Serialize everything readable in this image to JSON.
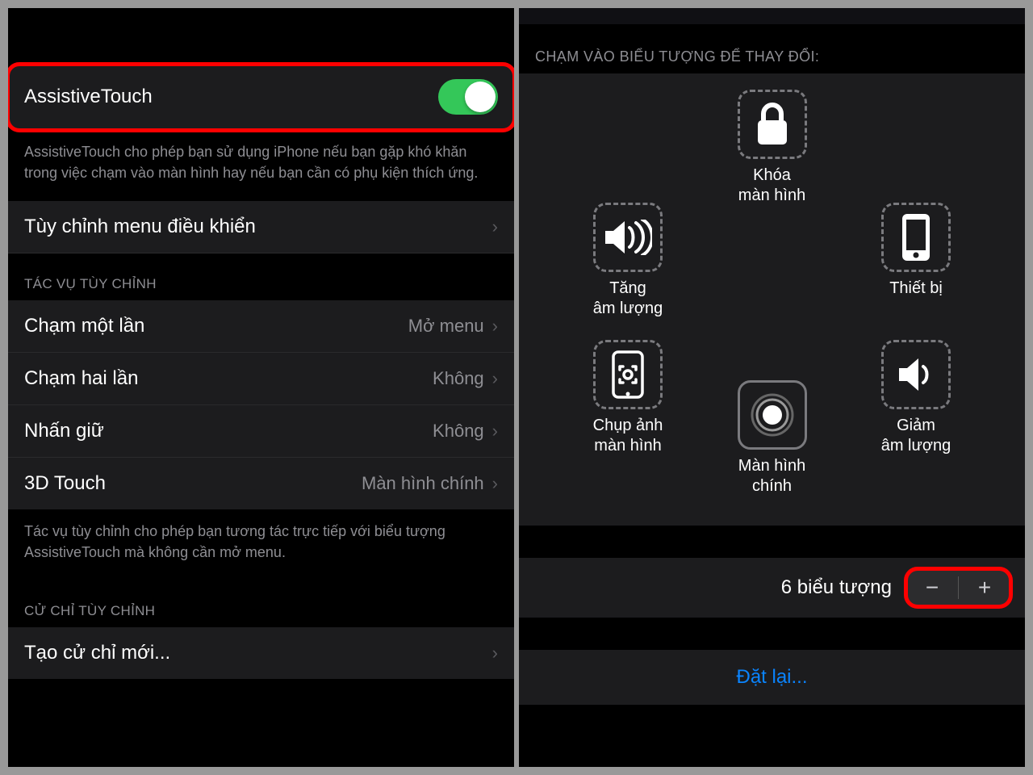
{
  "left": {
    "toggle_row": {
      "label": "AssistiveTouch"
    },
    "toggle_desc": "AssistiveTouch cho phép bạn sử dụng iPhone nếu bạn gặp khó khăn trong việc chạm vào màn hình hay nếu bạn cần có phụ kiện thích ứng.",
    "customize_row": "Tùy chỉnh menu điều khiển",
    "section_actions": "TÁC VỤ TÙY CHỈNH",
    "actions": [
      {
        "label": "Chạm một lần",
        "value": "Mở menu"
      },
      {
        "label": "Chạm hai lần",
        "value": "Không"
      },
      {
        "label": "Nhấn giữ",
        "value": "Không"
      },
      {
        "label": "3D Touch",
        "value": "Màn hình chính"
      }
    ],
    "actions_desc": "Tác vụ tùy chỉnh cho phép bạn tương tác trực tiếp với biểu tượng AssistiveTouch mà không cần mở menu.",
    "section_gesture": "CỬ CHỈ TÙY CHỈNH",
    "gesture_row": "Tạo cử chỉ mới..."
  },
  "right": {
    "header": "CHẠM VÀO BIỂU TƯỢNG ĐỂ THAY ĐỔI:",
    "slots": {
      "lock": "Khóa\nmàn hình",
      "volup": "Tăng\nâm lượng",
      "device": "Thiết bị",
      "screenshot": "Chụp ảnh\nmàn hình",
      "home": "Màn hình chính",
      "voldown": "Giảm\nâm lượng"
    },
    "count_label": "6 biểu tượng",
    "reset": "Đặt lại..."
  }
}
